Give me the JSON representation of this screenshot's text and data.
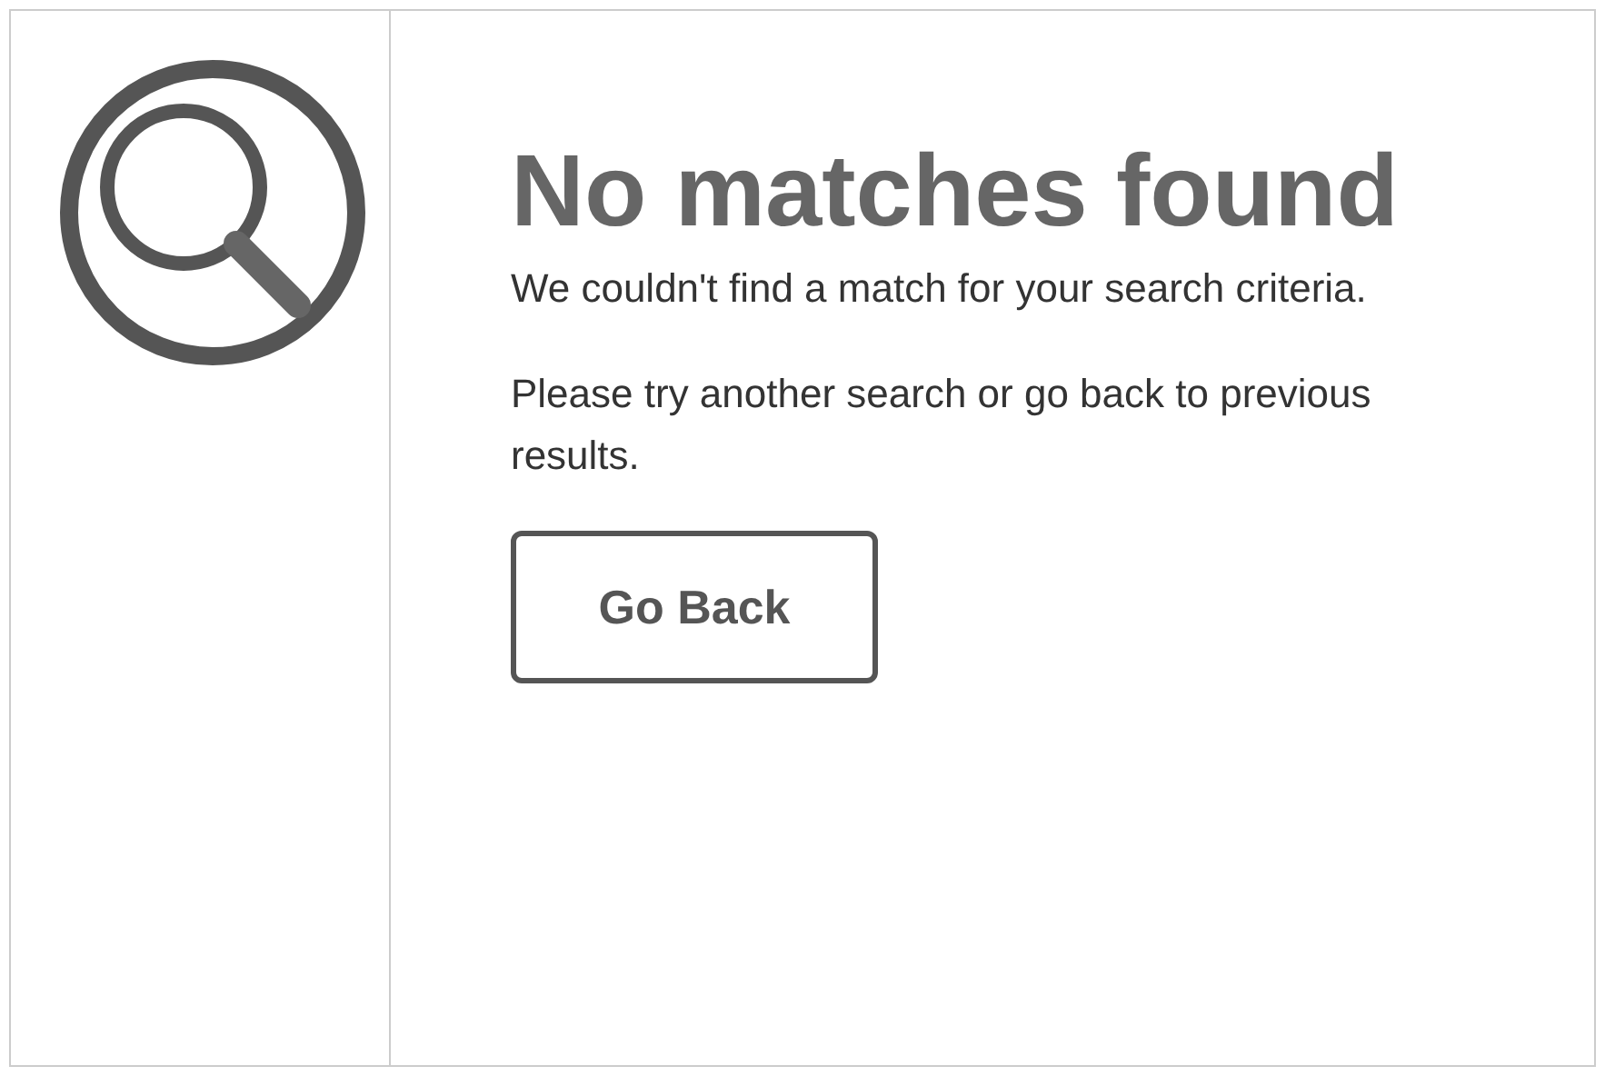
{
  "title": "No matches found",
  "paragraphs": [
    "We couldn't find a match for your search criteria.",
    "Please try another search or go back to previous results."
  ],
  "button": "Go Back"
}
